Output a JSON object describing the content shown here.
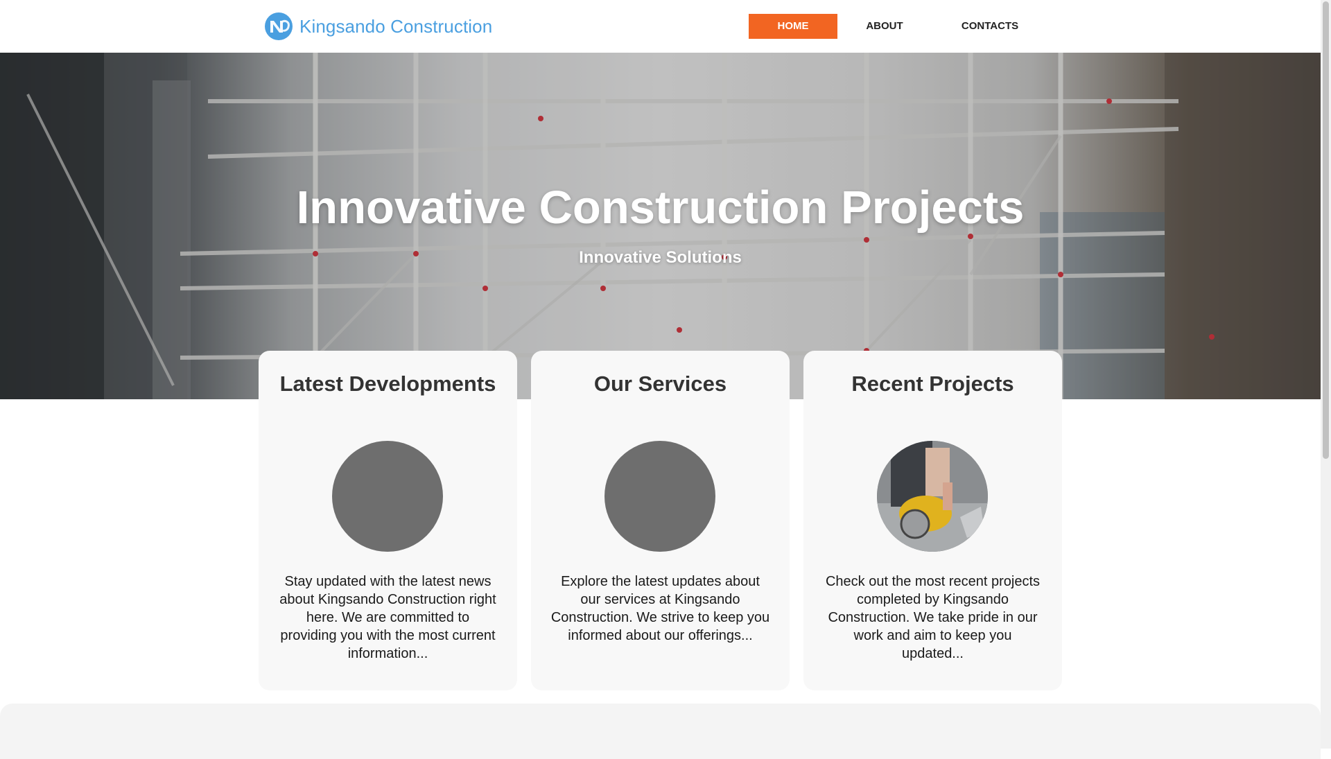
{
  "brand": {
    "name": "Kingsando Construction",
    "logo_icon": "nc-monogram-icon",
    "color": "#4a9fe0"
  },
  "nav": {
    "items": [
      {
        "label": "HOME",
        "active": true
      },
      {
        "label": "ABOUT",
        "active": false
      },
      {
        "label": "CONTACTS",
        "active": false
      }
    ],
    "active_color": "#f26522"
  },
  "hero": {
    "title": "Innovative Construction Projects",
    "subtitle": "Innovative Solutions",
    "image": "construction-scaffolding-photo"
  },
  "cards": [
    {
      "title": "Latest Developments",
      "image": "placeholder-gray-circle",
      "text": "Stay updated with the latest news about Kingsando Construction right here. We are committed to providing you with the most current information..."
    },
    {
      "title": "Our Services",
      "image": "placeholder-gray-circle",
      "text": "Explore the latest updates about our services at Kingsando Construction. We strive to keep you informed about our offerings..."
    },
    {
      "title": "Recent Projects",
      "image": "worker-cutting-tile-photo",
      "text": "Check out the most recent projects completed by Kingsando Construction. We take pride in our work and aim to keep you updated..."
    }
  ]
}
